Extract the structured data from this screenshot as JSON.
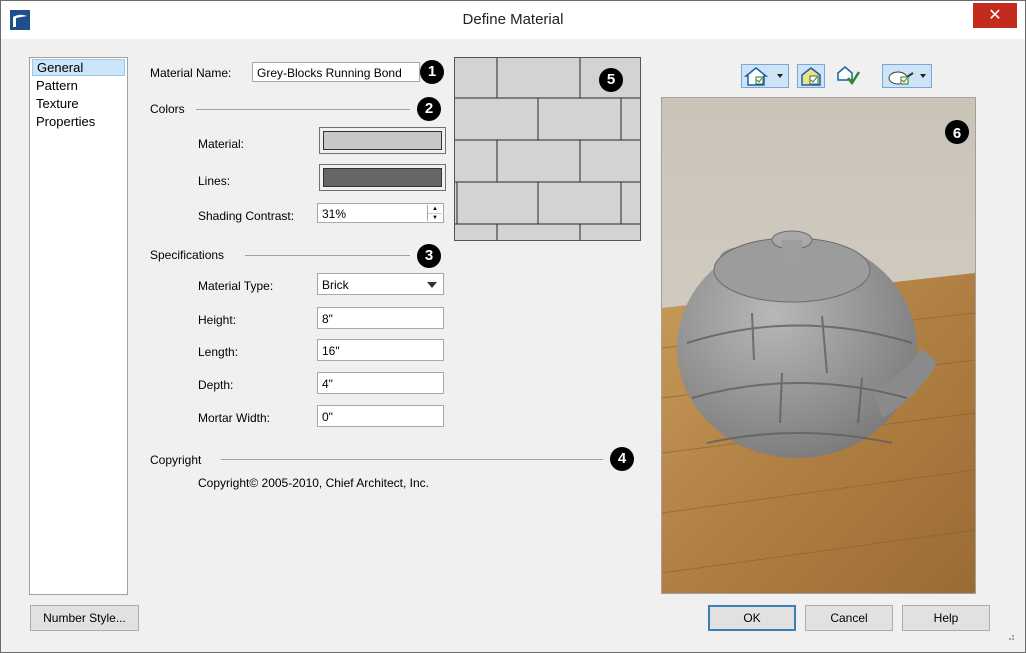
{
  "window": {
    "title": "Define Material",
    "close_symbol": "✕"
  },
  "nav": {
    "items": [
      "General",
      "Pattern",
      "Texture",
      "Properties"
    ],
    "selected": "General"
  },
  "general": {
    "material_name_label": "Material Name:",
    "material_name_value": "Grey-Blocks Running Bond",
    "colors_heading": "Colors",
    "material_label": "Material:",
    "material_color": "#c8c8c8",
    "lines_label": "Lines:",
    "lines_color": "#666666",
    "shading_label": "Shading Contrast:",
    "shading_value": "31%",
    "specs_heading": "Specifications",
    "material_type_label": "Material Type:",
    "material_type_value": "Brick",
    "height_label": "Height:",
    "height_value": "8\"",
    "length_label": "Length:",
    "length_value": "16\"",
    "depth_label": "Depth:",
    "depth_value": "4\"",
    "mortar_label": "Mortar Width:",
    "mortar_value": "0\"",
    "copyright_heading": "Copyright",
    "copyright_text": "Copyright© 2005-2010, Chief Architect, Inc."
  },
  "callouts": [
    "1",
    "2",
    "3",
    "4",
    "5",
    "6"
  ],
  "buttons": {
    "number_style": "Number Style...",
    "ok": "OK",
    "cancel": "Cancel",
    "help": "Help"
  },
  "toolbar_icons": [
    "house-room-icon",
    "room-interior-icon",
    "check-house-icon",
    "teapot-object-icon"
  ],
  "colors": {
    "close": "#c42b1c",
    "accent": "#3c7fb1",
    "selection": "#cce4f7"
  }
}
